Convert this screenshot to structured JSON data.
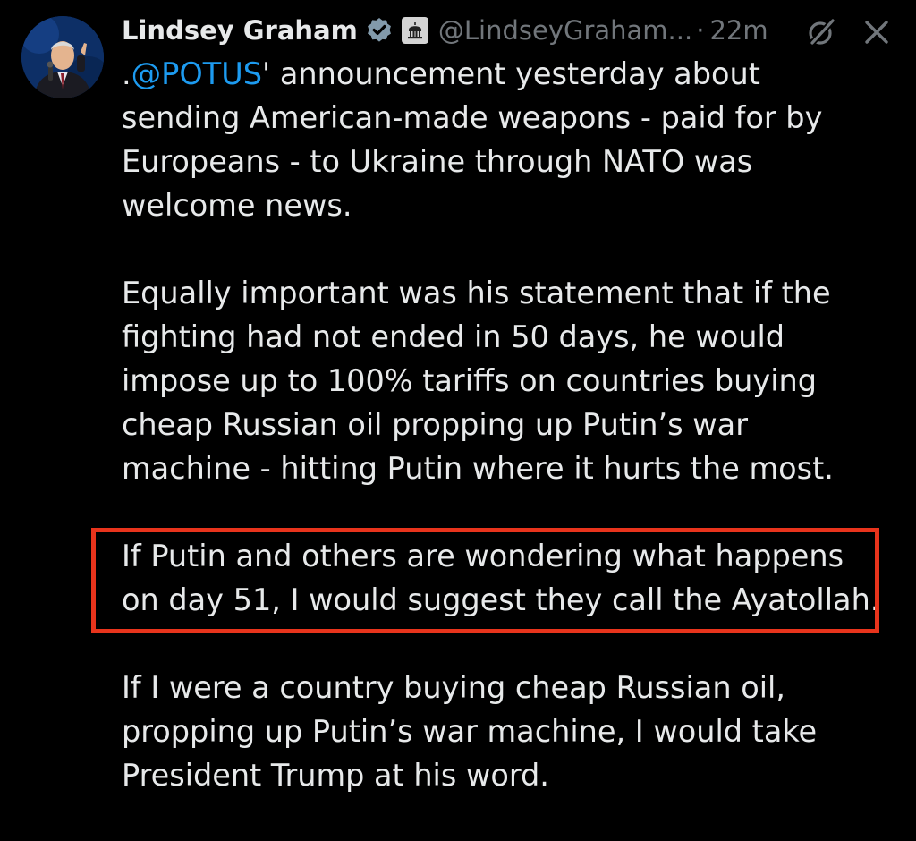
{
  "author": {
    "display_name": "Lindsey Graham",
    "handle": "@LindseyGraham...",
    "separator": "·",
    "timestamp": "22m"
  },
  "icons": {
    "verified": "verified-checkmark-icon",
    "gov": "government-building-icon",
    "grok": "grok-icon",
    "close": "close-icon"
  },
  "colors": {
    "background": "#000000",
    "text": "#e7e9ea",
    "muted": "#71767b",
    "mention": "#1d9bf0",
    "highlight": "#e8341c"
  },
  "tweet": {
    "paragraph_1": {
      "prefix": ".",
      "mention": "@POTUS",
      "text": "' announcement yesterday about\nsending American-made weapons  - paid for by\nEuropeans - to Ukraine through NATO was\nwelcome news."
    },
    "paragraph_2": "Equally important was his statement that if the\nfighting had not ended in 50 days, he would\nimpose up to 100% tariffs on countries buying\ncheap Russian oil propping up Putin’s war\nmachine - hitting Putin where it hurts the most.",
    "paragraph_3": "If Putin and others are wondering what happens\non day 51, I would suggest they call the Ayatollah.",
    "paragraph_4": "If I were a country buying cheap Russian oil,\npropping up Putin’s war machine, I would take\nPresident Trump at his word."
  }
}
